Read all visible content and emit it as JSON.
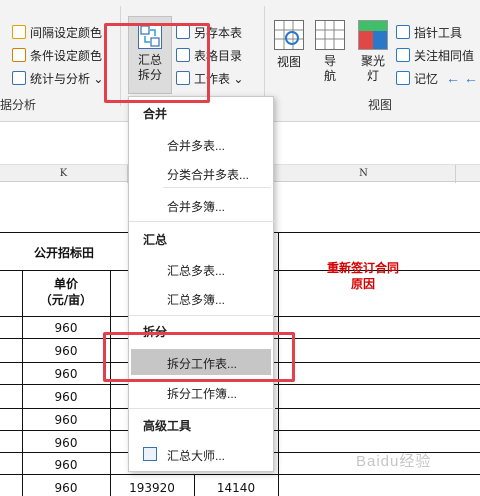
{
  "ribbon": {
    "left_items": [
      "间隔设定颜色",
      "条件设定颜色",
      "统计与分析 ⌄"
    ],
    "left_group_label": "据分析",
    "main_button": "汇总拆分",
    "mid_items": [
      "另存本表",
      "表格目录",
      "工作表 ⌄"
    ],
    "view_buttons": [
      "视图",
      "导航",
      "聚光灯"
    ],
    "right_items": [
      "指针工具",
      "关注相同值",
      "记忆"
    ],
    "view_group_label": "视图",
    "arrows": "← ←"
  },
  "sheet": {
    "col_headers": [
      "K",
      "N"
    ],
    "title_cell": "公开招标田",
    "unit_price_label": "单价\n（元/亩）",
    "reason_header": "重新签订合同\n原因",
    "prices": [
      "960",
      "960",
      "960",
      "960",
      "960",
      "960",
      "960",
      "960"
    ],
    "last_row_extra": [
      "193920",
      "14140"
    ]
  },
  "dropdown": {
    "sections": [
      {
        "header": "合并",
        "items": [
          "合并多表...",
          "分类合并多表...",
          "合并多簿..."
        ]
      },
      {
        "header": "汇总",
        "items": [
          "汇总多表...",
          "汇总多簿..."
        ]
      },
      {
        "header": "拆分",
        "items": [
          "拆分工作表...",
          "拆分工作簿..."
        ]
      },
      {
        "header": "高级工具",
        "items": [
          "汇总大师..."
        ]
      }
    ]
  },
  "watermark": "Baidu经验",
  "colors": {
    "highlight_box": "#e0414a",
    "red_text": "#d40000",
    "hover": "#c6c6c6"
  }
}
